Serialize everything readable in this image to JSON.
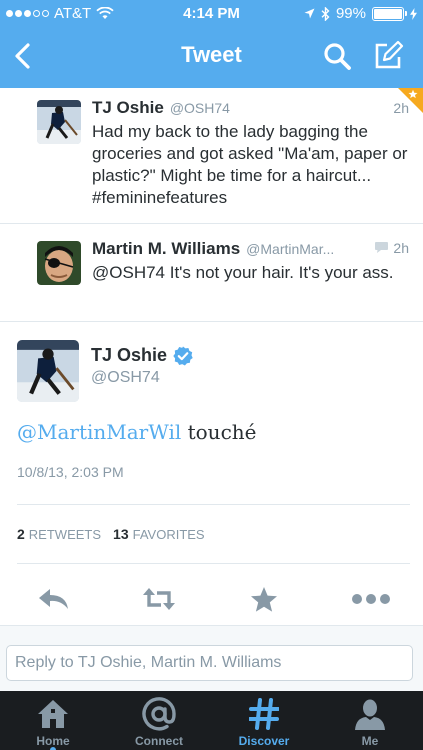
{
  "status_bar": {
    "carrier": "AT&T",
    "time": "4:14 PM",
    "battery": "99%",
    "battery_level": 0.99
  },
  "nav": {
    "title": "Tweet",
    "back_icon": "chevron-left-icon",
    "search_icon": "search-icon",
    "compose_icon": "compose-icon"
  },
  "conversation": [
    {
      "name": "TJ Oshie",
      "handle": "@OSH74",
      "time": "2h",
      "text": "Had my back to the lady bagging the groceries and got asked \"Ma'am, paper or plastic?\" Might be time for a haircut... #femininefeatures"
    },
    {
      "name": "Martin M. Williams",
      "handle": "@MartinMar...",
      "time": "2h",
      "text": "@OSH74 It's not your hair. It's your ass."
    }
  ],
  "main_tweet": {
    "name": "TJ Oshie",
    "handle": "@OSH74",
    "mention": "@MartinMarWil",
    "text": " touché",
    "date": "10/8/13, 2:03 PM",
    "retweets_count": "2",
    "retweets_label": "RETWEETS",
    "favorites_count": "13",
    "favorites_label": "FAVORITES"
  },
  "reply": {
    "placeholder": "Reply to TJ Oshie, Martin M. Williams"
  },
  "tabs": [
    {
      "label": "Home",
      "icon": "home-icon"
    },
    {
      "label": "Connect",
      "icon": "at-icon"
    },
    {
      "label": "Discover",
      "icon": "hashtag-icon"
    },
    {
      "label": "Me",
      "icon": "person-icon"
    }
  ],
  "colors": {
    "accent": "#55acee",
    "tabbar": "#1a1d20",
    "verified": "#55acee",
    "corner_fold": "#f6a91f"
  }
}
